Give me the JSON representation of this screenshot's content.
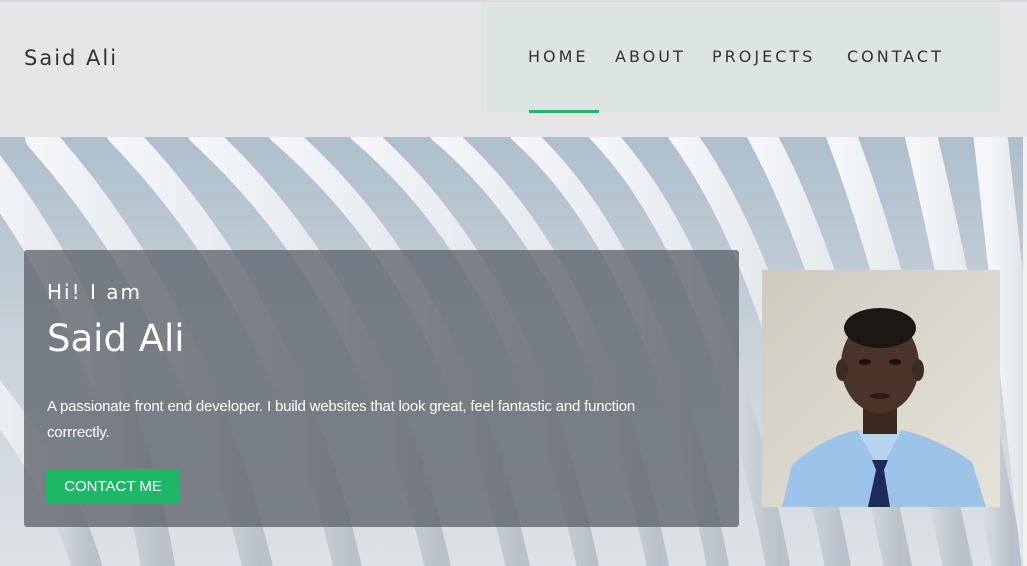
{
  "header": {
    "brand": "Said Ali",
    "nav": [
      {
        "label": "HOME",
        "active": true
      },
      {
        "label": "ABOUT",
        "active": false
      },
      {
        "label": "PROJECTS",
        "active": false
      },
      {
        "label": "CONTACT",
        "active": false
      }
    ]
  },
  "hero": {
    "greeting": "Hi! I am",
    "name": "Said Ali",
    "description": "A passionate front end developer. I build websites that look great, feel fantastic and function corrrectly.",
    "cta_label": "CONTACT ME"
  },
  "colors": {
    "accent": "#1db767",
    "header_bg": "#e6e6e6",
    "nav_bg": "#dde5e1",
    "card_bg": "#5f646c"
  }
}
